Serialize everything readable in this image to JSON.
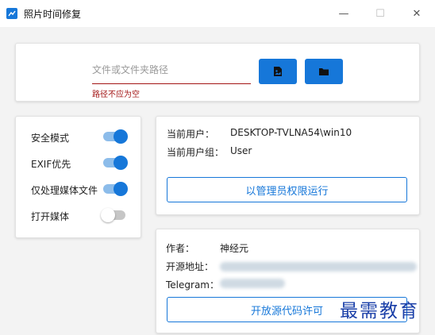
{
  "window": {
    "title": "照片时间修复",
    "controls": {
      "minimize": "—",
      "maximize": "☐",
      "close": "✕"
    }
  },
  "path_panel": {
    "input_placeholder": "文件或文件夹路径",
    "input_value": "",
    "error_text": "路径不应为空",
    "file_button_icon": "file-image-icon",
    "folder_button_icon": "folder-icon"
  },
  "options": [
    {
      "label": "安全模式",
      "on": true
    },
    {
      "label": "EXIF优先",
      "on": true
    },
    {
      "label": "仅处理媒体文件",
      "on": true
    },
    {
      "label": "打开媒体",
      "on": false
    }
  ],
  "user_panel": {
    "current_user_label": "当前用户：",
    "current_user_value": "DESKTOP-TVLNA54\\win10",
    "current_group_label": "当前用户组：",
    "current_group_value": "User",
    "run_as_admin_label": "以管理员权限运行"
  },
  "about_panel": {
    "author_label": "作者：",
    "author_value": "神经元",
    "repo_label": "开源地址：",
    "telegram_label": "Telegram：",
    "license_button_label": "开放源代码许可"
  },
  "watermark_text": "最需教育",
  "colors": {
    "accent": "#1677d9",
    "error": "#a31515",
    "background": "#f3f3f3"
  }
}
